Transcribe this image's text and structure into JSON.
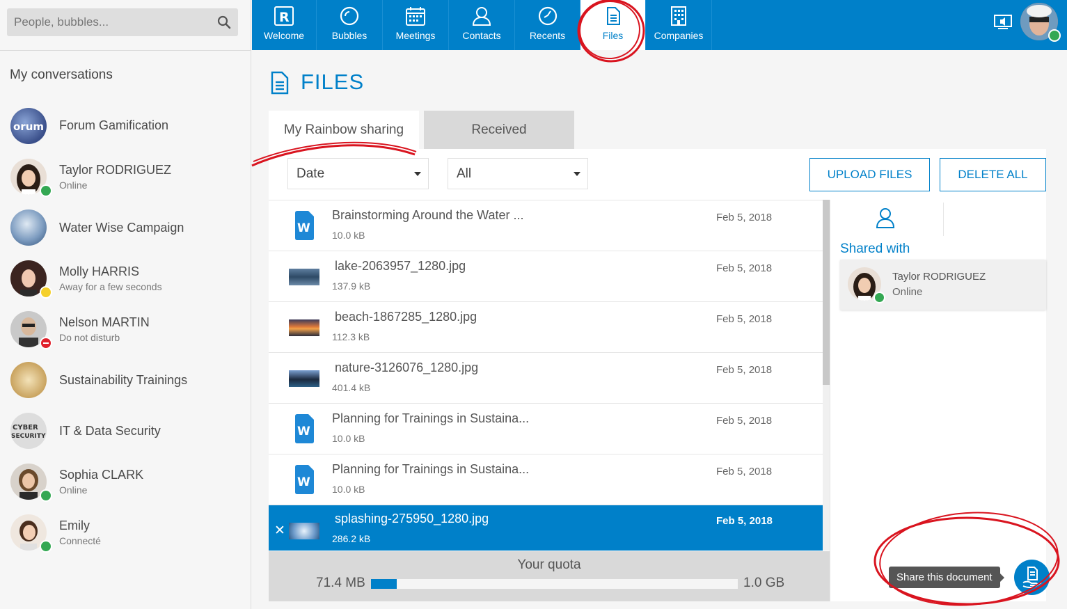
{
  "search": {
    "placeholder": "People, bubbles..."
  },
  "sidebar": {
    "title": "My conversations",
    "conversations": [
      {
        "name": "Forum Gamification",
        "status": "",
        "status_color": ""
      },
      {
        "name": "Taylor RODRIGUEZ",
        "status": "Online",
        "status_color": "#34a853"
      },
      {
        "name": "Water Wise Campaign",
        "status": "",
        "status_color": ""
      },
      {
        "name": "Molly HARRIS",
        "status": "Away for a few seconds",
        "status_color": "#f5d02b"
      },
      {
        "name": "Nelson MARTIN",
        "status": "Do not disturb",
        "status_color": "#e0202b"
      },
      {
        "name": "Sustainability Trainings",
        "status": "",
        "status_color": ""
      },
      {
        "name": "IT & Data Security",
        "status": "",
        "status_color": ""
      },
      {
        "name": "Sophia CLARK",
        "status": "Online",
        "status_color": "#34a853"
      },
      {
        "name": "Emily",
        "status": "Connecté",
        "status_color": "#34a853"
      }
    ]
  },
  "nav": {
    "tabs": [
      {
        "label": "Welcome",
        "icon": "rainbow-r-icon"
      },
      {
        "label": "Bubbles",
        "icon": "bubble-icon"
      },
      {
        "label": "Meetings",
        "icon": "calendar-icon"
      },
      {
        "label": "Contacts",
        "icon": "user-icon"
      },
      {
        "label": "Recents",
        "icon": "clock-icon"
      },
      {
        "label": "Files",
        "icon": "document-icon",
        "active": true
      },
      {
        "label": "Companies",
        "icon": "building-icon"
      }
    ]
  },
  "page": {
    "title": "FILES",
    "tab_mine": "My Rainbow sharing",
    "tab_received": "Received",
    "sort_select": "Date",
    "filter_select": "All",
    "upload_button": "UPLOAD FILES",
    "delete_button": "DELETE ALL"
  },
  "files": [
    {
      "name": "Brainstorming Around the Water ...",
      "size": "10.0 kB",
      "date": "Feb 5, 2018",
      "type": "word"
    },
    {
      "name": "lake-2063957_1280.jpg",
      "size": "137.9 kB",
      "date": "Feb 5, 2018",
      "type": "image"
    },
    {
      "name": "beach-1867285_1280.jpg",
      "size": "112.3 kB",
      "date": "Feb 5, 2018",
      "type": "image"
    },
    {
      "name": "nature-3126076_1280.jpg",
      "size": "401.4 kB",
      "date": "Feb 5, 2018",
      "type": "image"
    },
    {
      "name": "Planning for Trainings in Sustaina...",
      "size": "10.0 kB",
      "date": "Feb 5, 2018",
      "type": "word"
    },
    {
      "name": "Planning for Trainings in Sustaina...",
      "size": "10.0 kB",
      "date": "Feb 5, 2018",
      "type": "word"
    },
    {
      "name": "splashing-275950_1280.jpg",
      "size": "286.2 kB",
      "date": "Feb 5, 2018",
      "type": "image",
      "selected": true
    }
  ],
  "quota": {
    "title": "Your quota",
    "used": "71.4 MB",
    "total": "1.0 GB",
    "fraction": 0.07
  },
  "shared": {
    "label": "Shared with",
    "contact_name": "Taylor RODRIGUEZ",
    "contact_status": "Online"
  },
  "share_tooltip": "Share this document",
  "colors": {
    "accent": "#0080c9",
    "online": "#34a853",
    "annotation": "#d9141f"
  }
}
